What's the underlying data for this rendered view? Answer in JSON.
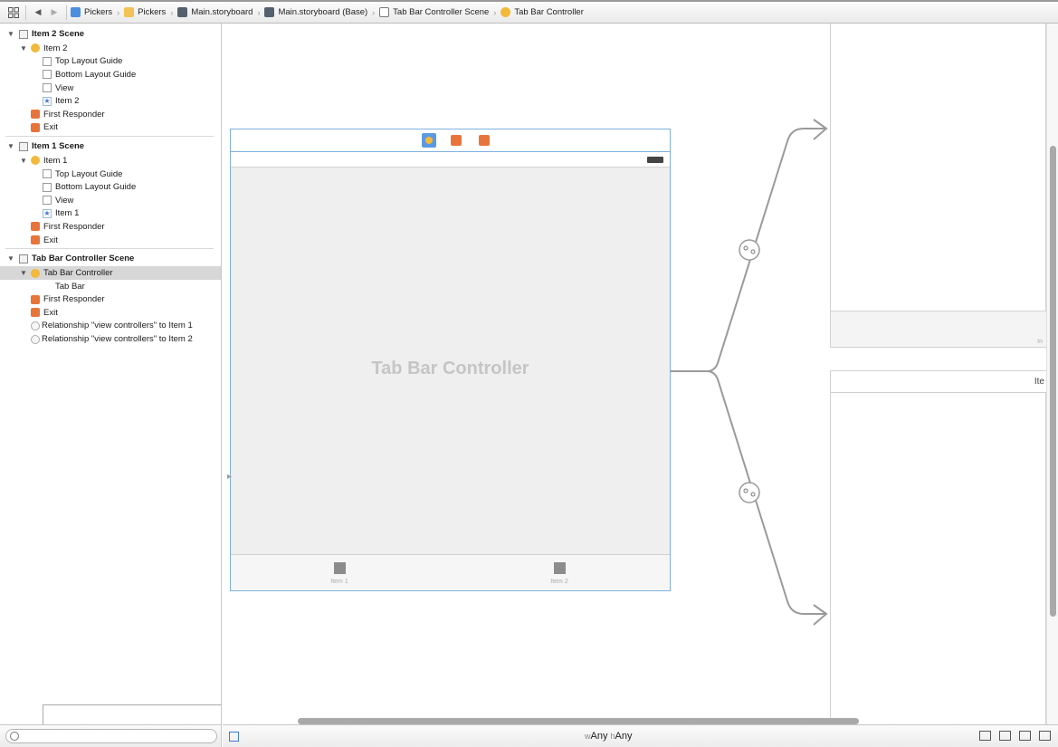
{
  "jumpbar": {
    "grid_icon": "grid-icon",
    "back_icon": "◀",
    "forward_icon": "▶",
    "crumbs": [
      "Pickers",
      "Pickers",
      "Main.storyboard",
      "Main.storyboard (Base)",
      "Tab Bar Controller Scene",
      "Tab Bar Controller"
    ]
  },
  "outline": {
    "scene2": {
      "title": "Item 2 Scene",
      "controller": "Item 2",
      "children": [
        "Top Layout Guide",
        "Bottom Layout Guide",
        "View",
        "Item 2"
      ],
      "first_responder": "First Responder",
      "exit": "Exit"
    },
    "scene1": {
      "title": "Item 1 Scene",
      "controller": "Item 1",
      "children": [
        "Top Layout Guide",
        "Bottom Layout Guide",
        "View",
        "Item 1"
      ],
      "first_responder": "First Responder",
      "exit": "Exit"
    },
    "tbc_scene": {
      "title": "Tab Bar Controller Scene",
      "controller": "Tab Bar Controller",
      "tab_bar": "Tab Bar",
      "first_responder": "First Responder",
      "exit": "Exit",
      "relationships": [
        "Relationship \"view controllers\" to Item 1",
        "Relationship \"view controllers\" to Item 2"
      ]
    }
  },
  "canvas": {
    "vc_title": "Tab Bar Controller",
    "tabs": [
      "Item 1",
      "Item 2"
    ],
    "right_scene_top_tab_label": "In",
    "right_scene_bottom_nav_title": "Ite"
  },
  "bottombar": {
    "w_prefix": "w",
    "w_value": "Any",
    "h_prefix": "h",
    "h_value": "Any"
  },
  "colors": {
    "selection_border": "#7fb0e0",
    "segue_line": "#9a9a9a",
    "vc_icon": "#f2b93a",
    "responder_icon": "#e8743b"
  }
}
